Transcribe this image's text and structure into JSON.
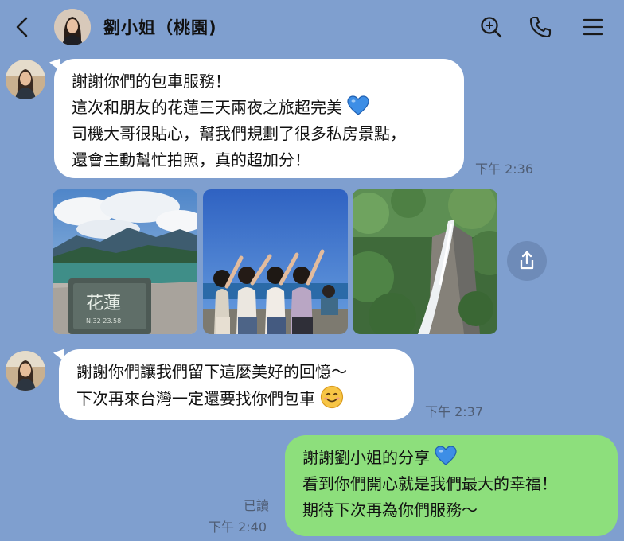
{
  "header": {
    "title": "劉小姐（桃園)",
    "icons": [
      "back-icon",
      "search-icon",
      "phone-icon",
      "menu-icon"
    ]
  },
  "messages": [
    {
      "side": "incoming",
      "lines": [
        "謝謝你們的包車服務！",
        "這次和朋友的花蓮三天兩夜之旅超完美",
        "司機大哥很貼心，幫我們規劃了很多私房景點，",
        "還會主動幫忙拍照，真的超加分！"
      ],
      "emoji_after_line": 1,
      "emoji": "blue-heart",
      "time": "下午 2:36"
    },
    {
      "side": "incoming",
      "type": "photos",
      "photos": [
        {
          "name": "lake-photo",
          "sign_text": "花蓮",
          "sign_subtext": "N.32 23.58"
        },
        {
          "name": "friends-photo"
        },
        {
          "name": "waterfall-photo"
        }
      ]
    },
    {
      "side": "incoming",
      "lines": [
        "謝謝你們讓我們留下這麼美好的回憶～",
        "下次再來台灣一定還要找你們包車"
      ],
      "emoji_after_line": 1,
      "emoji": "smiling-face",
      "time": "下午 2:37"
    },
    {
      "side": "outgoing",
      "lines": [
        "謝謝劉小姐的分享",
        "看到你們開心就是我們最大的幸福！",
        "期待下次再為你們服務～"
      ],
      "emoji_after_line": 0,
      "emoji": "blue-heart",
      "read_label": "已讀",
      "time": "下午 2:40"
    }
  ],
  "colors": {
    "background": "#7f9fcf",
    "incoming_bubble": "#ffffff",
    "outgoing_bubble": "#8ddf7c",
    "heart": "#3d8ee6"
  }
}
